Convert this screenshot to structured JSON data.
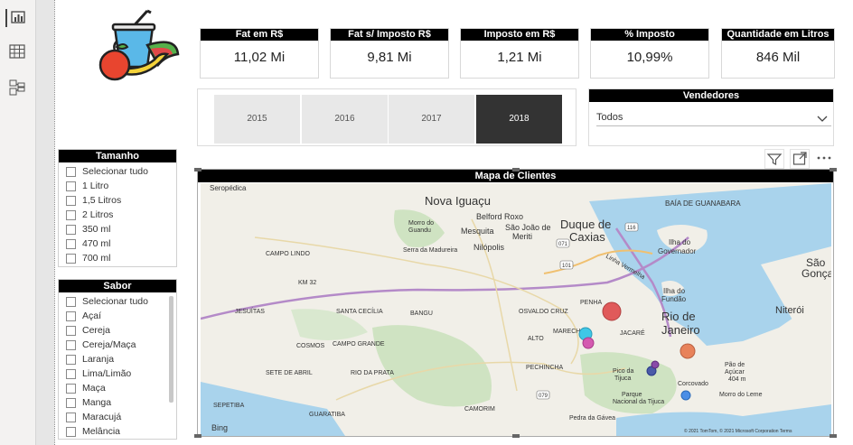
{
  "rail": {
    "icons": [
      "bar-chart-icon",
      "table-icon",
      "model-icon"
    ]
  },
  "kpis": [
    {
      "title": "Fat em R$",
      "value": "11,02 Mi"
    },
    {
      "title": "Fat s/ Imposto R$",
      "value": "9,81 Mi"
    },
    {
      "title": "Imposto em R$",
      "value": "1,21 Mi"
    },
    {
      "title": "% Imposto",
      "value": "10,99%"
    },
    {
      "title": "Quantidade em Litros",
      "value": "846 Mil"
    }
  ],
  "years": {
    "items": [
      "2015",
      "2016",
      "2017",
      "2018"
    ],
    "selected": "2018"
  },
  "vendedores": {
    "title": "Vendedores",
    "value": "Todos"
  },
  "tamanho": {
    "title": "Tamanho",
    "items": [
      "Selecionar tudo",
      "1 Litro",
      "1,5 Litros",
      "2 Litros",
      "350 ml",
      "470 ml",
      "700 ml"
    ]
  },
  "sabor": {
    "title": "Sabor",
    "items": [
      "Selecionar tudo",
      "Açaí",
      "Cereja",
      "Cereja/Maça",
      "Laranja",
      "Lima/Limão",
      "Maça",
      "Manga",
      "Maracujá",
      "Melância"
    ]
  },
  "map": {
    "title": "Mapa de Clientes",
    "attribution": "© 2021 TomTom, © 2021 Microsoft Corporation Terms",
    "bing": "Bing",
    "labels": {
      "seropedica": "Seropédica",
      "nova_iguacu": "Nova Iguaçu",
      "belford_roxo": "Belford Roxo",
      "sao_joao": "São João de",
      "meriti": "Meriti",
      "mesquita": "Mesquita",
      "nilopolis": "Nilópolis",
      "duque": "Duque de",
      "caxias": "Caxias",
      "baia": "BAÍA DE GUANABARA",
      "morro_do": "Morro do",
      "guandu": "Guandu",
      "serra": "Serra da Madureira",
      "campo_lindo": "CAMPO LINDO",
      "km32": "KM 32",
      "jesuitas": "JESUÍTAS",
      "santa_cecilia": "SANTA CECÍLIA",
      "bangu": "BANGU",
      "oswaldo": "OSVALDO CRUZ",
      "penha": "PENHA",
      "ilha_gov": "Ilha do",
      "governador": "Governador",
      "ilha_fundao": "Ilha do",
      "fundao": "Fundão",
      "rio": "Rio de",
      "janeiro": "Janeiro",
      "sao": "São",
      "goncalo": "Gonçalo",
      "niteroi": "Niterói",
      "cosmos": "COSMOS",
      "campo_grande": "CAMPO GRANDE",
      "jacare": "JACARÉ",
      "alto": "ALTO",
      "marechal": "MARECHAL",
      "sete_abril": "SETE DE ABRIL",
      "rio_prata": "RIO DA PRATA",
      "pechincha": "PECHINCHA",
      "pico": "Pico da",
      "tijuca": "Tijuca",
      "parque": "Parque",
      "nacional": "Nacional da Tijuca",
      "pao": "Pão de",
      "acucar": "Açúcar",
      "acucar_m": "404 m",
      "corcovado": "Corcovado",
      "morro_leme": "Morro do Leme",
      "sepetiba": "SEPETIBA",
      "guaratiba": "GUARATIBA",
      "camorim": "CAMORIM",
      "pedra": "Pedra da Gávea",
      "linha": "Linha Vermelha",
      "r101": "101",
      "r116": "116",
      "r071": "071",
      "r079": "079"
    }
  },
  "colors": {
    "header": "#000000",
    "year_selected": "#333333",
    "bubble_red": "#e05a5a",
    "bubble_cyan": "#3fc7e6",
    "bubble_pink": "#d45ab0",
    "bubble_orange": "#e8825a",
    "bubble_navy": "#4a5aa8",
    "bubble_blue": "#4a8ee6",
    "bubble_purple": "#8a4aa8",
    "water": "#a9d3ec",
    "land": "#f1efe8"
  },
  "icons": [
    "filter-icon",
    "focus-mode-icon",
    "more-options-icon",
    "chevron-down-icon",
    "juice-logo"
  ]
}
